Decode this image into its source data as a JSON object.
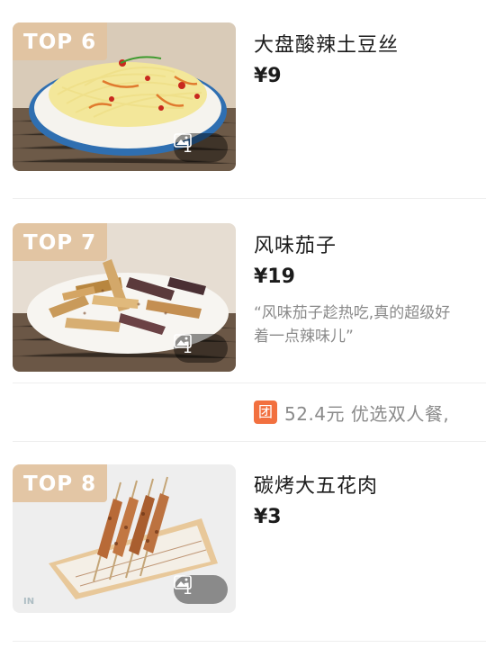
{
  "items": [
    {
      "rank": "TOP 6",
      "name": "大盘酸辣土豆丝",
      "price": "¥9",
      "photo_count": "1",
      "photo_icon": "image-icon"
    },
    {
      "rank": "TOP 7",
      "name": "风味茄子",
      "price": "¥19",
      "review_line1": "“风味茄子趁热吃,真的超级好",
      "review_line2": "着一点辣味儿”",
      "photo_count": "1",
      "photo_icon": "image-icon"
    },
    {
      "rank": "TOP 8",
      "name": "碳烤大五花肉",
      "price": "¥3",
      "photo_count": "1",
      "photo_icon": "image-icon",
      "watermark": "IN"
    }
  ],
  "deal": {
    "icon_label": "团",
    "text": "52.4元 优选双人餐,",
    "icon_color": "#f2703f"
  },
  "colors": {
    "rank_tag_bg": "#e1c3a0",
    "price_text": "#1b1b1b",
    "muted_text": "#8a8a8a"
  }
}
